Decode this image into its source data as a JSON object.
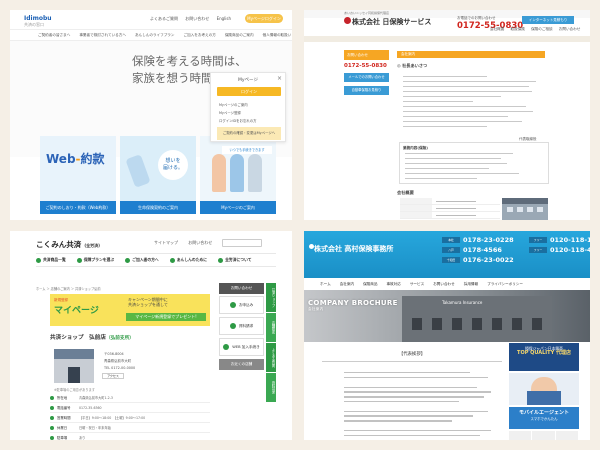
{
  "panel1": {
    "logo": "Idimobu",
    "logo_sub": "共済の窓口",
    "header_links": [
      "よくあるご質問",
      "お問い合わせ",
      "English"
    ],
    "header_button": "Myページログイン",
    "nav": [
      "ご契約者の皆さまへ",
      "事業者で検討されている方へ",
      "あんしんのライフプラン",
      "ご加入をお考えの方",
      "保険商品のご案内",
      "個人情報の取扱い",
      "会社情報"
    ],
    "hero_line1": "保険を考える時間は、",
    "hero_line2": "家族を想う時間。",
    "mypage": {
      "title": "Myページ",
      "login": "ログイン",
      "link1": "Myページのご案内",
      "link2": "Myページ登録",
      "link3": "ログインIDをお忘れの方",
      "footer": "ご契約の確認・変更はMyページへ"
    },
    "cards": {
      "web_big": "Web",
      "web_big2": "約款",
      "web_caption": "ご契約のしおり・約款（Web約款）",
      "c2_bubble_1": "想いを",
      "c2_bubble_2": "届ける。",
      "c2_caption": "生命保険契約のご案内",
      "c3_bar": "いつでも手続きできます",
      "c3_caption": "Myページのご案内"
    },
    "colors": {
      "brand": "#1e7fcf",
      "accent": "#f6b824"
    }
  },
  "panel2": {
    "topnote": "あいおいニッセイ同和損保代理店",
    "logo": "株式会社 日保険サービス",
    "tel_label": "お電話でのお問い合わせ",
    "tel": "0172-55-0830",
    "top_button": "インターネット見積もり",
    "nav": [
      "会社概要",
      "取扱保険",
      "保険のご相談",
      "お問い合わせ"
    ],
    "side_head": "お問い合わせ",
    "side_tel": "0172-55-0830",
    "side_btn1": "メールでのお問い合わせ",
    "side_btn2": "自動車保険お見積り",
    "section": "会社案内",
    "greeting": "◎ 社長あいさつ",
    "signature": "代表取締役",
    "box_title": "業務内容(保険)",
    "company_title": "会社概要"
  },
  "panel3": {
    "logo": "こくみん共済",
    "logo_sub": "(全労済)",
    "header_links": [
      "サイトマップ",
      "お問い合わせ"
    ],
    "gnav": [
      "共済商品一覧",
      "保障プランを選ぶ",
      "ご加入者の方へ",
      "あんしんのために",
      "全労済について"
    ],
    "crumbs": "ホーム ＞ 店舗のご案内 ＞ 共済ショップ弘前",
    "promo_left": "マイページ",
    "promo_left_sub": "新規登録",
    "promo_right_1": "キャンペーン期間中に",
    "promo_right_2": "共済ショップを通して",
    "promo_green": "マイページ新規登録でプレゼント!",
    "title": "共済ショップ　弘前店",
    "title_sub": "（弘前支所）",
    "shop_info": [
      "〒036-8004",
      "青森県弘前市大町",
      "TEL 0172-00-0000"
    ],
    "access": "アクセス",
    "caption": "※駐車場のご用意があります",
    "rows": [
      {
        "k": "所在地",
        "v": "青森県弘前市大町1-2-3"
      },
      {
        "k": "電話番号",
        "v": "0172-35-6360"
      },
      {
        "k": "営業時間",
        "v": "【平日】9:00〜18:00　【土曜】9:00〜17:00"
      },
      {
        "k": "休業日",
        "v": "日曜・祝日・年末年始"
      },
      {
        "k": "駐車場",
        "v": "あり"
      }
    ],
    "right_header": "お問い合わせ",
    "right_tiles": [
      "お申込み",
      "資料請求",
      "WEB 加入手続き"
    ],
    "right_footer": "お近くの店舗",
    "vtabs": [
      "共済ショップ",
      "店舗検索",
      "よくある質問",
      "資料請求"
    ]
  },
  "panel4": {
    "logo": "株式会社 高村保険事務所",
    "phones": [
      {
        "label": "本社",
        "num": "0178-23-0228",
        "label2": "フリー",
        "num2": "0120-118-118"
      },
      {
        "label": "八戸",
        "num": "0178-4566",
        "label2": "フリー",
        "num2": "0120-118-404"
      },
      {
        "label": "十和田",
        "num": "0176-23-0022",
        "label2": "",
        "num2": ""
      }
    ],
    "nav": [
      "ホーム",
      "会社案内",
      "保険商品",
      "事故対応",
      "サービス",
      "お問い合わせ",
      "採用情報",
      "プライバシーポリシー",
      "アクセス"
    ],
    "brochure": "COMPANY BROCHURE",
    "brochure_sub": "会社案内",
    "hero_sign": "Takamura Insurance",
    "main_title": "【代表挨拶】",
    "aside_top_1": "損保ジャパン日本興亜",
    "aside_top_2": "TOP QUALITY 代理店",
    "aside_mobile": "モバイル",
    "aside_mobile_2": "エージェント",
    "aside_mobile_sub": "スマホでかんたん"
  }
}
